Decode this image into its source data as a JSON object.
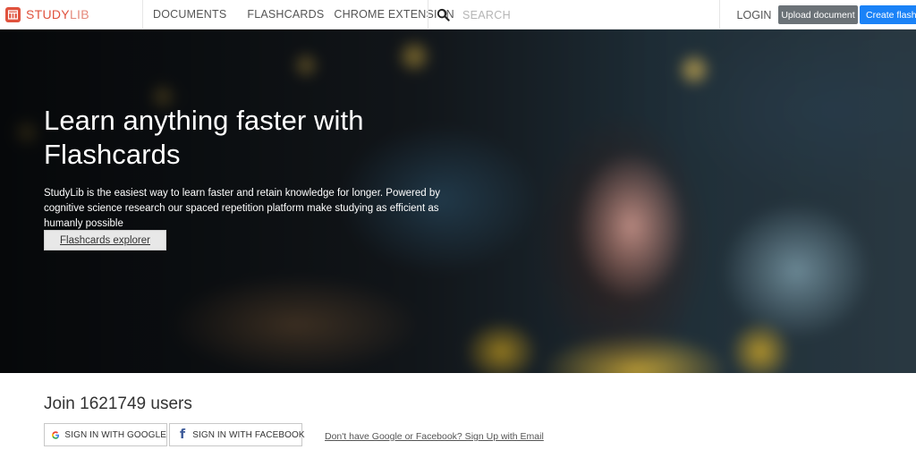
{
  "brand": {
    "name_part1": "STUDY",
    "name_part2": "LIB",
    "logo_icon": "studylib-logo-icon",
    "accent_color": "#e0523d"
  },
  "nav": {
    "items": [
      {
        "label": "DOCUMENTS"
      },
      {
        "label": "FLASHCARDS"
      },
      {
        "label": "CHROME EXTENSION"
      }
    ],
    "search_icon": "search-icon",
    "search_placeholder": "SEARCH",
    "login_label": "LOGIN",
    "upload_label": "Upload document",
    "create_label": "Create flashcards",
    "upload_color": "#6b7277",
    "create_color": "#1a82f7"
  },
  "hero": {
    "title_line1": "Learn anything faster with",
    "title_line2": "Flashcards",
    "description": "StudyLib is the easiest way to learn faster and retain knowledge for longer. Powered by cognitive science research our spaced repetition platform make studying as efficient as humanly possible",
    "explorer_button": "Flashcards explorer"
  },
  "join": {
    "title": "Join 1621749 users",
    "google_button": "SIGN IN WITH GOOGLE",
    "google_icon": "google-icon",
    "facebook_button": "SIGN IN WITH FACEBOOK",
    "facebook_icon": "facebook-icon",
    "signup_link": "Don't have Google or Facebook? Sign Up with Email"
  }
}
